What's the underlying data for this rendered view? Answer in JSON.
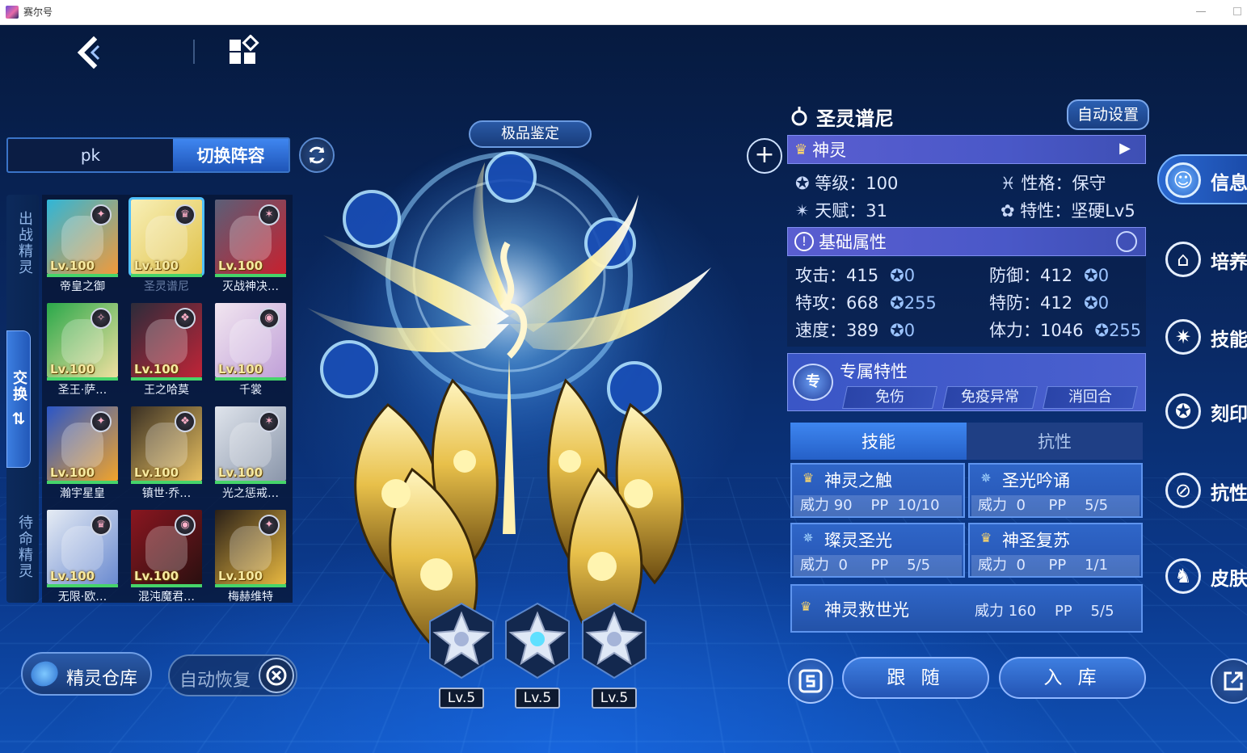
{
  "window": {
    "title": "赛尔号"
  },
  "top_nav": {
    "back_icon": "chevron-left-icon",
    "menu_icon": "grid-menu-icon"
  },
  "team_tabs": {
    "pk": "pk",
    "switch": "切换阵容"
  },
  "side_labels": {
    "battle": "出战精灵",
    "swap": "交换",
    "swap_arrows": "⇅",
    "standby": "待命精灵"
  },
  "pets": [
    {
      "name": "帝皇之御",
      "lv": "Lv.100",
      "badge": "✦",
      "colors": [
        "#2fb6d8",
        "#f29a3a"
      ]
    },
    {
      "name": "圣灵谱尼",
      "lv": "Lv.100",
      "badge": "♛",
      "colors": [
        "#f8f0b8",
        "#e0c24a"
      ],
      "selected": true
    },
    {
      "name": "灭战神决…",
      "lv": "Lv.100",
      "badge": "✶",
      "colors": [
        "#5a5f78",
        "#c8202e"
      ]
    },
    {
      "name": "圣王·萨…",
      "lv": "Lv.100",
      "badge": "✧",
      "colors": [
        "#2aa84a",
        "#f0e0a0"
      ]
    },
    {
      "name": "王之哈莫",
      "lv": "Lv.100",
      "badge": "❖",
      "colors": [
        "#2c2c3a",
        "#c02438"
      ]
    },
    {
      "name": "千裳",
      "lv": "Lv.100",
      "badge": "◉",
      "colors": [
        "#f2e6f0",
        "#c0a0d8"
      ]
    },
    {
      "name": "瀚宇星皇",
      "lv": "Lv.100",
      "badge": "✦",
      "colors": [
        "#2a56c8",
        "#f2a42a"
      ]
    },
    {
      "name": "镇世·乔…",
      "lv": "Lv.100",
      "badge": "❖",
      "colors": [
        "#3a3024",
        "#e8c060"
      ]
    },
    {
      "name": "光之惩戒…",
      "lv": "Lv.100",
      "badge": "✶",
      "colors": [
        "#dfe4ec",
        "#8a96aa"
      ]
    },
    {
      "name": "无限·欧…",
      "lv": "Lv.100",
      "badge": "♛",
      "colors": [
        "#e6ecf4",
        "#6a8ad0"
      ]
    },
    {
      "name": "混沌魔君…",
      "lv": "Lv.100",
      "badge": "◉",
      "colors": [
        "#8a1620",
        "#2a1010"
      ]
    },
    {
      "name": "梅赫维特",
      "lv": "Lv.100",
      "badge": "✦",
      "colors": [
        "#2a2018",
        "#e8b840"
      ]
    }
  ],
  "bottom_left": {
    "storage": "精灵仓库",
    "auto_recover": "自动恢复"
  },
  "hero": {
    "appraise": "极品鉴定"
  },
  "gems": [
    {
      "lv": "Lv.5"
    },
    {
      "lv": "Lv.5"
    },
    {
      "lv": "Lv.5"
    }
  ],
  "info": {
    "name": "圣灵谱尼",
    "auto_set": "自动设置",
    "type_label": "神灵",
    "level": "等级：100",
    "nature": "性格：保守",
    "talent": "天赋：31",
    "trait": "特性：坚硬Lv5",
    "base_attr": "基础属性",
    "stats": [
      {
        "label": "攻击：415",
        "ev": "0"
      },
      {
        "label": "防御：412",
        "ev": "0"
      },
      {
        "label": "特攻：668",
        "ev": "255"
      },
      {
        "label": "特防：412",
        "ev": "0"
      },
      {
        "label": "速度：389",
        "ev": "0"
      },
      {
        "label": "体力：1046",
        "ev": "255"
      }
    ],
    "exclusive": {
      "icon": "专",
      "title": "专属特性",
      "tags": [
        "免伤",
        "免疫异常",
        "消回合"
      ]
    },
    "skill_tabs": {
      "skills": "技能",
      "resist": "抗性"
    },
    "skills": [
      {
        "name": "神灵之触",
        "stat": "威力 90    PP  10/10",
        "icon": "♛"
      },
      {
        "name": "圣光吟诵",
        "stat": "威力  0     PP    5/5",
        "icon": "✵"
      },
      {
        "name": "璨灵圣光",
        "stat": "威力  0     PP    5/5",
        "icon": "✵"
      },
      {
        "name": "神圣复苏",
        "stat": "威力  0     PP    1/1",
        "icon": "♛"
      }
    ],
    "ultimate": {
      "name": "神灵救世光",
      "stat": "威力 160    PP    5/5",
      "icon": "♛"
    }
  },
  "bottom_right": {
    "follow": "跟 随",
    "store": "入 库"
  },
  "right_menu": [
    {
      "label": "信息",
      "icon": "info-face-icon"
    },
    {
      "label": "培养",
      "icon": "cultivate-icon"
    },
    {
      "label": "技能",
      "icon": "skill-icon"
    },
    {
      "label": "刻印",
      "icon": "engrave-icon"
    },
    {
      "label": "抗性",
      "icon": "resist-icon"
    },
    {
      "label": "皮肤",
      "icon": "skin-icon"
    }
  ]
}
